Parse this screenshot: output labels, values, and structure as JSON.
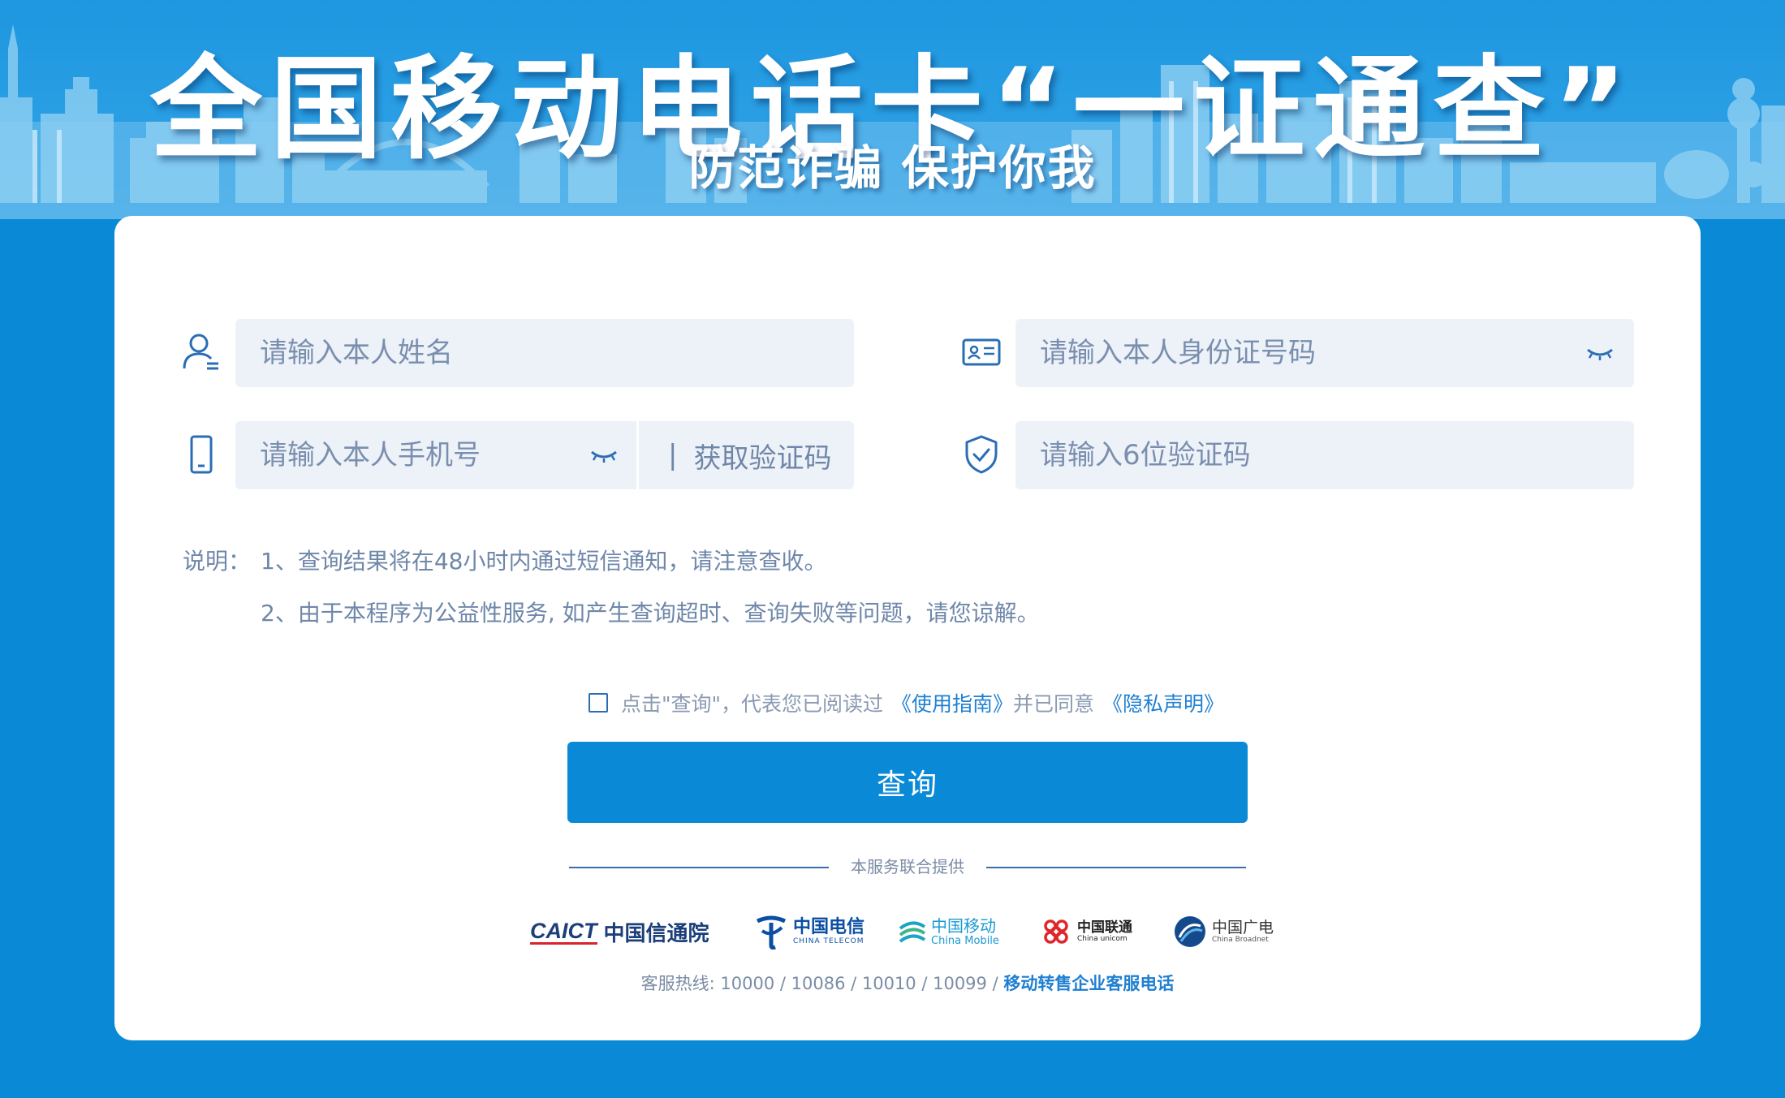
{
  "banner": {
    "title": "全国移动电话卡“一证通查”",
    "subtitle": "防范诈骗 保护你我"
  },
  "form": {
    "name_placeholder": "请输入本人姓名",
    "id_placeholder": "请输入本人身份证号码",
    "phone_placeholder": "请输入本人手机号",
    "get_code_bar": "|",
    "get_code_label": "获取验证码",
    "code_placeholder": "请输入6位验证码"
  },
  "notes": {
    "label": "说明：",
    "items": [
      "1、查询结果将在48小时内通过短信通知，请注意查收。",
      "2、由于本程序为公益性服务, 如产生查询超时、查询失败等问题，请您谅解。"
    ]
  },
  "agreement": {
    "text_before": "点击\"查询\"，代表您已阅读过",
    "guide_link": "《使用指南》",
    "text_middle": "并已同意",
    "privacy_link": "《隐私声明》"
  },
  "query_button": "查询",
  "provider_text": "本服务联合提供",
  "logos": {
    "caict": {
      "mark": "CAICT",
      "name": "中国信通院"
    },
    "telecom": {
      "name": "中国电信",
      "en": "CHINA TELECOM"
    },
    "mobile": {
      "name": "中国移动",
      "en": "China Mobile"
    },
    "unicom": {
      "name": "中国联通",
      "en": "China unicom"
    },
    "broadnet": {
      "name": "中国广电",
      "en": "China Broadnet"
    }
  },
  "hotline": {
    "text": "客服热线: 10000 / 10086 / 10010 / 10099 /",
    "link": "移动转售企业客服电话"
  },
  "colors": {
    "page_bg": "#0a8ad6",
    "field_bg": "#edf2f9",
    "accent": "#1f7fd1",
    "icon": "#2a6db5"
  },
  "icons": [
    "user-icon",
    "id-card-icon",
    "phone-icon",
    "shield-check-icon",
    "eye-closed-icon"
  ]
}
